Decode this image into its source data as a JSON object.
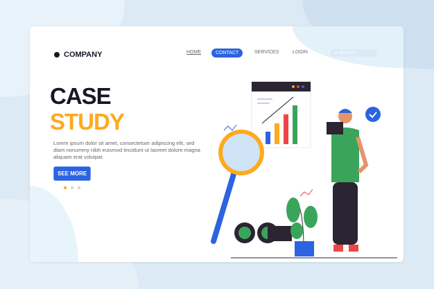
{
  "header": {
    "logo": "COMPANY",
    "nav": [
      "HOME",
      "CONTACT",
      "SERVICES",
      "LOGIN"
    ],
    "active_nav": "CONTACT",
    "search_placeholder": "SEARCH"
  },
  "hero": {
    "title_line1": "CASE",
    "title_line2": "STUDY",
    "description": "Lorem ipsum dolor sit amet, consectetuer adipiscing elit, sed diam nonummy nibh euismod tincidunt ut laoreet dolore magna aliquam erat volutpat.",
    "cta": "SEE MORE",
    "carousel": {
      "total": 3,
      "active": 1
    }
  },
  "colors": {
    "accent": "#2b63e0",
    "highlight": "#fdaa1d",
    "dark": "#1c1424"
  }
}
